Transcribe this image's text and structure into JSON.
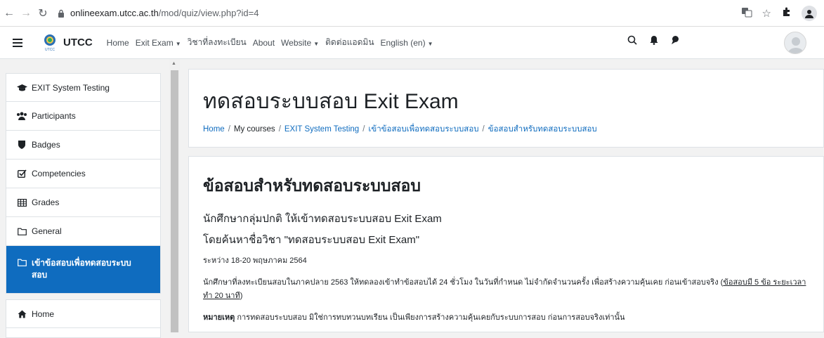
{
  "browser": {
    "url_host": "onlineexam.utcc.ac.th",
    "url_path": "/mod/quiz/view.php?id=4"
  },
  "navbar": {
    "brand": "UTCC",
    "menu": [
      {
        "label": "Home",
        "dropdown": false
      },
      {
        "label": "Exit Exam",
        "dropdown": true
      },
      {
        "label": "วิชาที่ลงทะเบียน",
        "dropdown": false
      },
      {
        "label": "About",
        "dropdown": false
      },
      {
        "label": "Website",
        "dropdown": true
      },
      {
        "label": "ติดต่อแอดมิน",
        "dropdown": false
      },
      {
        "label": "English (en)",
        "dropdown": true
      }
    ]
  },
  "sidebar": {
    "items": [
      {
        "label": "EXIT System Testing",
        "icon": "graduation-cap-icon"
      },
      {
        "label": "Participants",
        "icon": "users-icon"
      },
      {
        "label": "Badges",
        "icon": "shield-icon"
      },
      {
        "label": "Competencies",
        "icon": "checkbox-icon"
      },
      {
        "label": "Grades",
        "icon": "table-icon"
      },
      {
        "label": "General",
        "icon": "folder-icon"
      },
      {
        "label": "เข้าข้อสอบเพื่อทดสอบระบบสอบ",
        "icon": "folder-icon",
        "active": true
      },
      {
        "label": "Home",
        "icon": "home-icon"
      }
    ]
  },
  "header": {
    "title": "ทดสอบระบบสอบ Exit Exam",
    "breadcrumb": [
      "Home",
      "My courses",
      "EXIT System Testing",
      "เข้าข้อสอบเพื่อทดสอบระบบสอบ",
      "ข้อสอบสำหรับทดสอบระบบสอบ"
    ]
  },
  "content": {
    "title": "ข้อสอบสำหรับทดสอบระบบสอบ",
    "line1": "นักศึกษากลุ่มปกติ ให้เข้าทดสอบระบบสอบ Exit Exam",
    "line2": "โดยค้นหาชื่อวิชา \"ทดสอบระบบสอบ Exit Exam\"",
    "date": "ระหว่าง 18-20 พฤษภาคม 2564",
    "para": "นักศึกษาที่ลงทะเบียนสอบในภาคปลาย 2563 ให้ทดลองเข้าทำข้อสอบได้ 24 ชั่วโมง ในวันที่กำหนด ไม่จำกัดจำนวนครั้ง เพื่อสร้างความคุ้นเคย ก่อนเข้าสอบจริง (",
    "para_link": "ข้อสอบมี 5 ข้อ ระยะเวลาทำ 20 นาที",
    "para_end": ")",
    "note_label": "หมายเหตุ",
    "note_text": " การทดสอบระบบสอบ มิใช่การทบทวนบทเรียน เป็นเพียงการสร้างความคุ้นเคยกับระบบการสอบ ก่อนการสอบจริงเท่านั้น"
  }
}
